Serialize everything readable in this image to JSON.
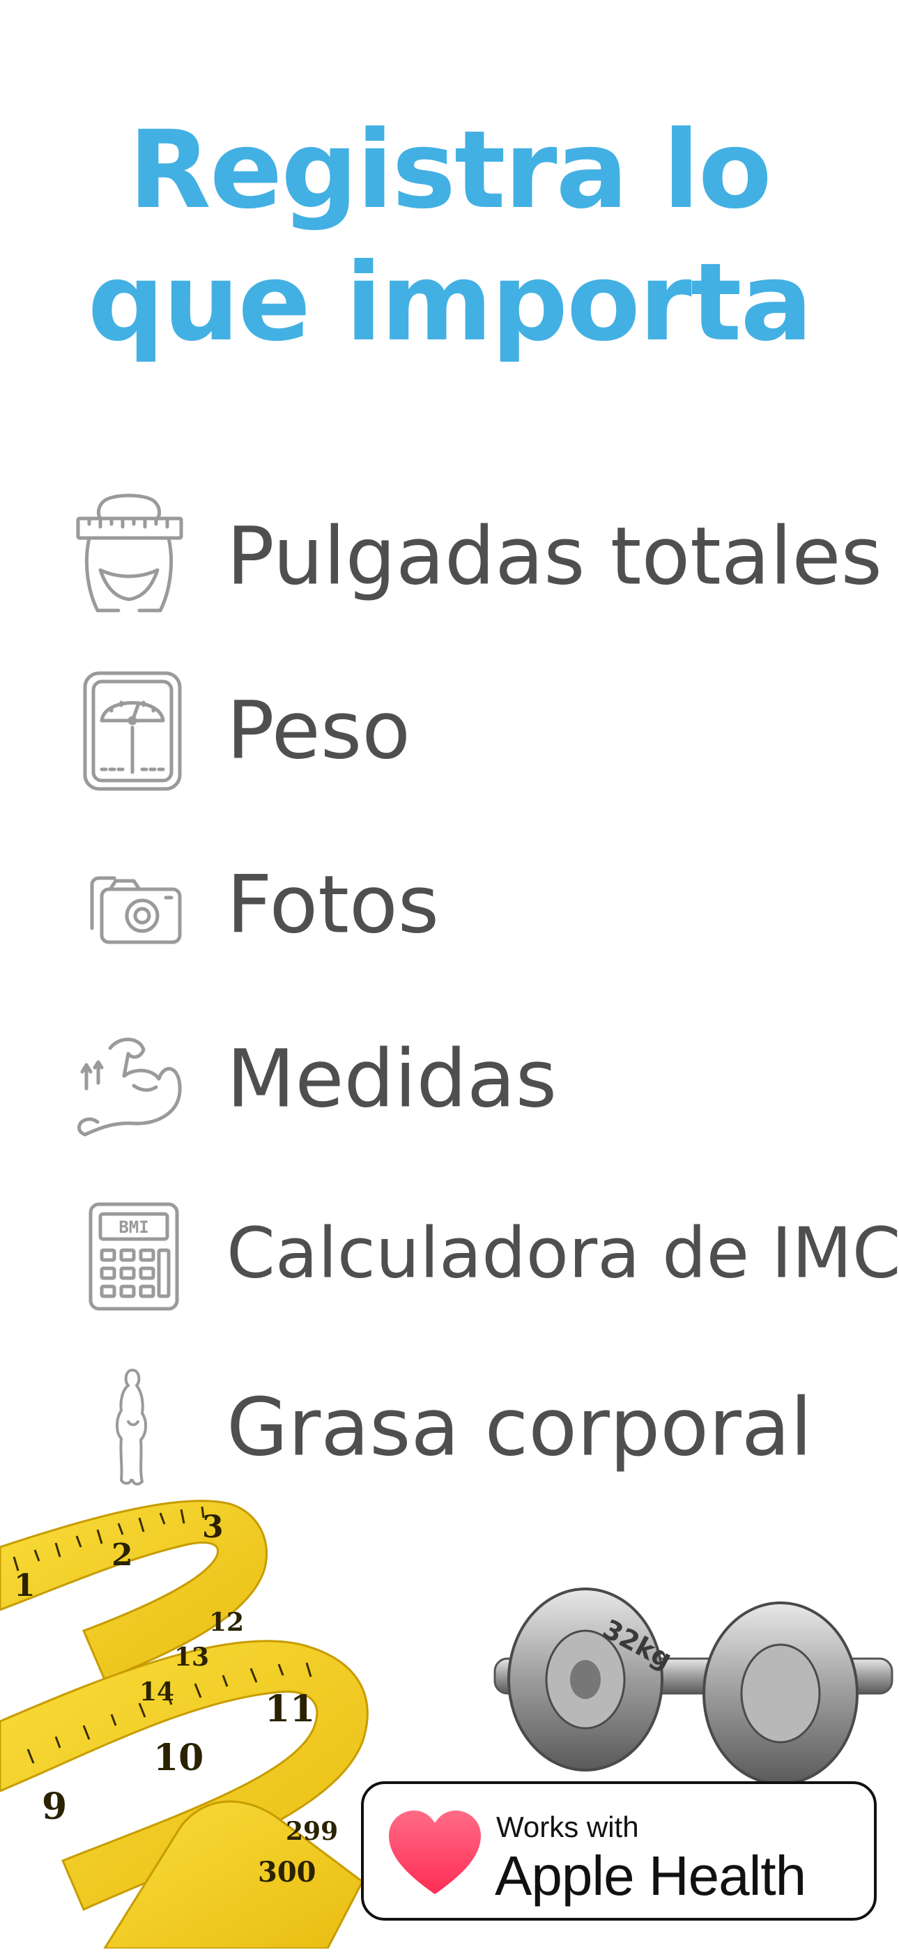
{
  "headline": {
    "line1": "Registra lo",
    "line2": "que importa"
  },
  "features": [
    {
      "label": "Pulgadas totales",
      "icon": "waist-measure-icon"
    },
    {
      "label": "Peso",
      "icon": "bathroom-scale-icon"
    },
    {
      "label": "Fotos",
      "icon": "camera-photos-icon"
    },
    {
      "label": "Medidas",
      "icon": "flexed-arm-icon"
    },
    {
      "label": "Calculadora de IMC",
      "icon": "bmi-calculator-icon",
      "icon_text": "BMI"
    },
    {
      "label": "Grasa corporal",
      "icon": "body-silhouette-icon"
    }
  ],
  "decor": {
    "tape_numbers": [
      "1",
      "2",
      "3",
      "9",
      "10",
      "11",
      "12",
      "13",
      "14",
      "300",
      "299"
    ],
    "dumbbell_text": "32kg"
  },
  "badge": {
    "small_text": "Works with",
    "big_text": "Apple Health",
    "icon": "heart-icon"
  },
  "colors": {
    "headline": "#43b0e3",
    "label": "#4f4f4f",
    "icon_stroke": "#9a9a9a",
    "tape": "#f6d11f",
    "heart_top": "#ff6b86",
    "heart_bottom": "#ff2d55"
  }
}
